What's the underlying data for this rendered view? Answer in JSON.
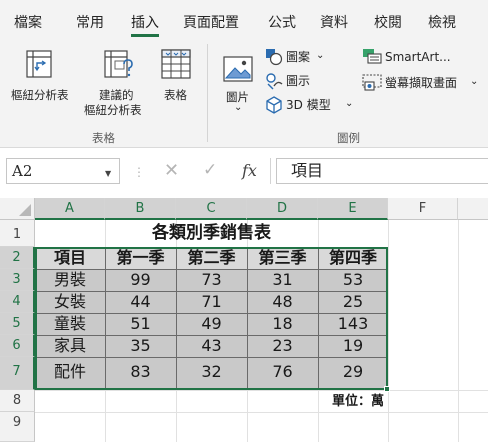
{
  "ribbon_tabs": [
    "檔案",
    "常用",
    "插入",
    "頁面配置",
    "公式",
    "資料",
    "校閱",
    "檢視"
  ],
  "active_tab": "插入",
  "ribbon": {
    "pivot_table": "樞紐分析表",
    "recommended_pivot_line1": "建議的",
    "recommended_pivot_line2": "樞紐分析表",
    "table": "表格",
    "group_tables": "表格",
    "picture": "圖片",
    "picture_caret": "⌄",
    "shapes": "圖案",
    "icons": "圖示",
    "model3d": "3D 模型",
    "smartart": "SmartArt...",
    "screenshot": "螢幕擷取畫面",
    "group_illustrations": "圖例"
  },
  "formula_bar": {
    "name_box": "A2",
    "formula": "項目",
    "fx_label": "fx"
  },
  "columns": [
    "A",
    "B",
    "C",
    "D",
    "E",
    "F"
  ],
  "rows": [
    "1",
    "2",
    "3",
    "4",
    "5",
    "6",
    "7",
    "8",
    "9"
  ],
  "sheet": {
    "title": "各類別季銷售表",
    "headers": [
      "項目",
      "第一季",
      "第二季",
      "第三季",
      "第四季"
    ],
    "data": [
      [
        "男裝",
        "99",
        "73",
        "31",
        "53"
      ],
      [
        "女裝",
        "44",
        "71",
        "48",
        "25"
      ],
      [
        "童裝",
        "51",
        "49",
        "18",
        "143"
      ],
      [
        "家具",
        "35",
        "43",
        "23",
        "19"
      ],
      [
        "配件",
        "83",
        "32",
        "76",
        "29"
      ]
    ],
    "unit_note": "單位：萬"
  },
  "colors": {
    "accent": "#217346",
    "data_fill": "#c9c9c9",
    "header_fill": "#d9d9d9"
  }
}
